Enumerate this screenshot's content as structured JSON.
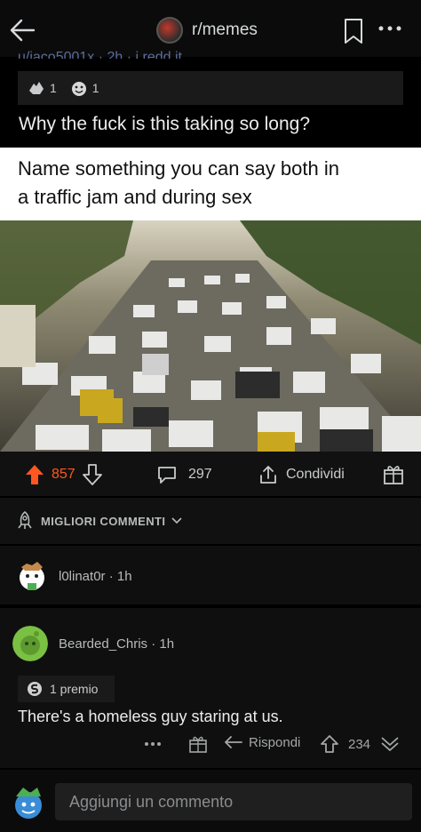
{
  "header": {
    "subreddit": "r/memes"
  },
  "post": {
    "faded_author_line": "u/jaco5001x · 2h · i.redd.it",
    "awards": [
      {
        "icon": "hands-award-icon",
        "count": "1"
      },
      {
        "icon": "wholesome-award-icon",
        "count": "1"
      }
    ],
    "title": "Why the fuck is this taking so long?",
    "meme_caption_line1": "Name something you can say both in",
    "meme_caption_line2": "a traffic jam and during sex",
    "upvotes": "857",
    "comments": "297",
    "share_label": "Condividi"
  },
  "sort": {
    "label": "MIGLIORI COMMENTI"
  },
  "comments": [
    {
      "user": "l0linat0r",
      "age": "1h"
    },
    {
      "user": "Bearded_Chris",
      "age": "1h",
      "award_label": "1 premio",
      "text": "There's a homeless guy staring at us.",
      "reply_label": "Rispondi",
      "score": "234"
    }
  ],
  "composer": {
    "placeholder": "Aggiungi un commento"
  },
  "colors": {
    "upvote": "#ff5722",
    "background": "#000000",
    "card": "#1a1a1b"
  }
}
